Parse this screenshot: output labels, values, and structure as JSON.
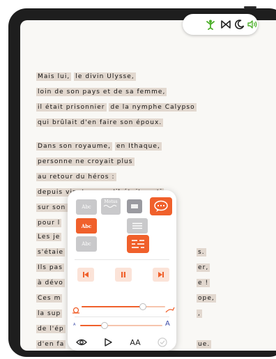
{
  "toolbar": {
    "icons": [
      "puppet-icon",
      "bowtie-icon",
      "moon-icon",
      "speaker-icon"
    ],
    "accent": "#4caf2a"
  },
  "text": {
    "lines": [
      [
        {
          "t": "Mais lui,",
          "u": false
        },
        {
          "t": "le divin Ulysse,",
          "u": false
        }
      ],
      [
        {
          "t": "loin de son pays et de sa femme,",
          "u": false
        }
      ],
      [
        {
          "t": "il était prisonnier",
          "u": false
        },
        {
          "t": "de la nymphe Calypso",
          "u": false
        }
      ],
      [
        {
          "t": "qui brûlait d'en faire son époux.",
          "u": false
        }
      ],
      [
        {
          "t": "Dans son royaume,",
          "u": false
        },
        {
          "t": "en Ithaque,",
          "u": false
        }
      ],
      [
        {
          "t": "personne ne croyait plus",
          "u": false
        }
      ],
      [
        {
          "t": "au retour du héros :",
          "u": false
        }
      ],
      [
        {
          "t": "depuis vingt ans qu'il était parti",
          "u": false
        }
      ],
      [
        {
          "t": "sur son navire arqué",
          "u": false
        }
      ]
    ],
    "partial_left": [
      "pour l",
      "Les je",
      "s'étaie",
      "Ils pas",
      "à dévo",
      "Ces m",
      "la sup",
      "de l'ép",
      "d'en fa"
    ],
    "partial_right": [
      "s.",
      "er,",
      "e !",
      "ope,",
      ",",
      "ue."
    ]
  },
  "panel": {
    "row1": [
      "Abc",
      "Motus",
      "",
      ""
    ],
    "row2": [
      "Abc",
      ""
    ],
    "row3": [
      "Abc",
      ""
    ],
    "font_small": "A",
    "font_large": "A",
    "text_size_label": "AA",
    "speed_level": 0.73,
    "size_level": 0.3,
    "colors": {
      "orange": "#f0602b",
      "grey": "#c9c9cb",
      "peach": "#fbe3d8"
    }
  }
}
